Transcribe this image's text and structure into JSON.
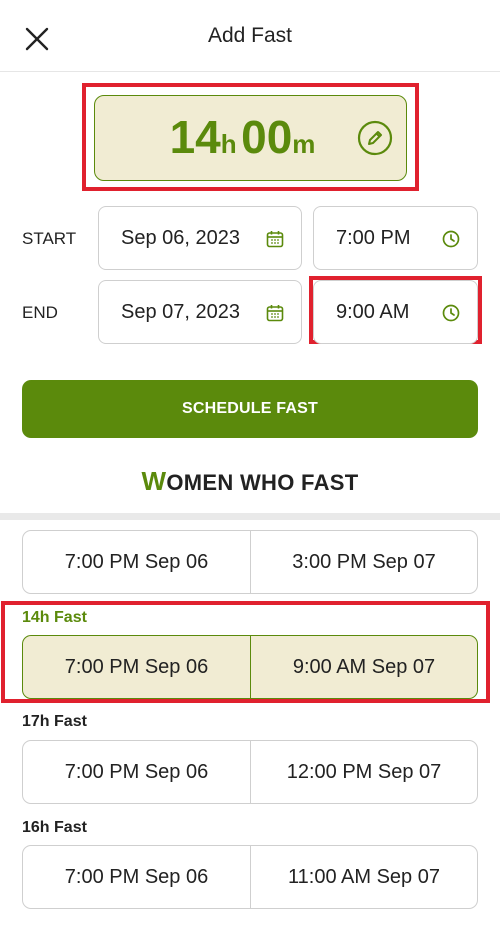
{
  "header": {
    "title": "Add Fast",
    "close_icon": "close-icon"
  },
  "duration": {
    "hours": "14",
    "hours_unit": "h",
    "minutes": "00",
    "minutes_unit": "m",
    "edit_icon": "pencil-edit-icon"
  },
  "start": {
    "label": "START",
    "date": "Sep 06, 2023",
    "time": "7:00 PM"
  },
  "end": {
    "label": "END",
    "date": "Sep 07, 2023",
    "time": "9:00 AM"
  },
  "schedule_button": "SCHEDULE FAST",
  "logo": {
    "first_letter": "W",
    "rest": "OMEN WHO FAST"
  },
  "suggestions": [
    {
      "label": "",
      "start": "7:00 PM Sep 06",
      "end": "3:00 PM Sep 07",
      "selected": false
    },
    {
      "label": "14h Fast",
      "start": "7:00 PM Sep 06",
      "end": "9:00 AM Sep 07",
      "selected": true
    },
    {
      "label": "17h Fast",
      "start": "7:00 PM Sep 06",
      "end": "12:00 PM Sep 07",
      "selected": false
    },
    {
      "label": "16h Fast",
      "start": "7:00 PM Sep 06",
      "end": "11:00 AM Sep 07",
      "selected": false
    }
  ],
  "colors": {
    "brand_green": "#5b8a0c",
    "selected_bg": "#f1ecd3",
    "highlight_red": "#e0212e"
  }
}
